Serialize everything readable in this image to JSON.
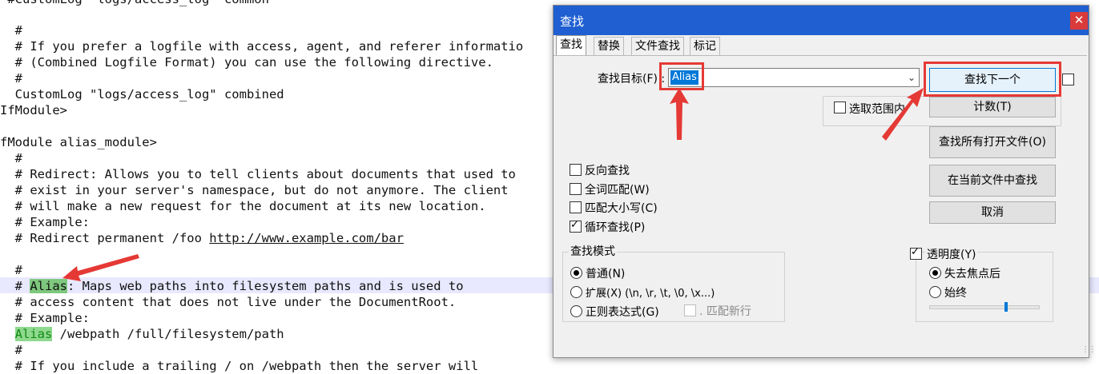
{
  "editor": {
    "lines": [
      {
        "text": " #CustomLog \"logs/access_log\" common"
      },
      {
        "text": ""
      },
      {
        "text": "  #"
      },
      {
        "text": "  # If you prefer a logfile with access, agent, and referer informatio"
      },
      {
        "text": "  # (Combined Logfile Format) you can use the following directive."
      },
      {
        "text": "  #"
      },
      {
        "text": "  CustomLog \"logs/access_log\" combined"
      },
      {
        "text": "IfModule>"
      },
      {
        "text": ""
      },
      {
        "text": "fModule alias_module>"
      },
      {
        "text": "  #"
      },
      {
        "text": "  # Redirect: Allows you to tell clients about documents that used to"
      },
      {
        "text": "  # exist in your server's namespace, but do not anymore. The client"
      },
      {
        "text": "  # will make a new request for the document at its new location."
      },
      {
        "text": "  # Example:"
      },
      {
        "text": "  # Redirect permanent /foo "
      },
      {
        "text": ""
      },
      {
        "text": "  #"
      },
      {
        "text": "  # "
      },
      {
        "text": "  # access content that does not live under the DocumentRoot."
      },
      {
        "text": "  # Example:"
      },
      {
        "text": "  "
      },
      {
        "text": "  #"
      },
      {
        "text": "  # If you include a trailing / on /webpath then the server will"
      }
    ],
    "redirect_url": "http://www.example.com/bar",
    "alias_keyword": "Alias",
    "alias_rest": ": Maps web paths into filesystem paths and is used to",
    "alias_example_rest": " /webpath /full/filesystem/path"
  },
  "dialog": {
    "title": "查找",
    "close_symbol": "✕",
    "tabs": [
      "查找",
      "替换",
      "文件查找",
      "标记"
    ],
    "find_target_label": "查找目标(F) :",
    "find_target_value": "Alias",
    "select_in_range_label": "选取范围内",
    "buttons": {
      "find_next": "查找下一个",
      "count": "计数(T)",
      "find_all_open": "查找所有打开文件(O)",
      "find_in_current": "在当前文件中查找",
      "cancel": "取消"
    },
    "options": {
      "reverse": "反向查找",
      "whole_word": "全词匹配(W)",
      "match_case": "匹配大小写(C)",
      "wrap": "循环查找(P)"
    },
    "mode": {
      "title": "查找模式",
      "normal": "普通(N)",
      "extended": "扩展(X) (\\n, \\r, \\t, \\0, \\x...)",
      "regex": "正则表达式(G)",
      "dot_newline": ". 匹配新行"
    },
    "transparency": {
      "label": "透明度(Y)",
      "on_lose_focus": "失去焦点后",
      "always": "始终",
      "level": 0.72
    },
    "colors": {
      "accent": "#0078d7",
      "titlebar": "#1f5fd1",
      "annotation_red": "#e53935"
    }
  }
}
